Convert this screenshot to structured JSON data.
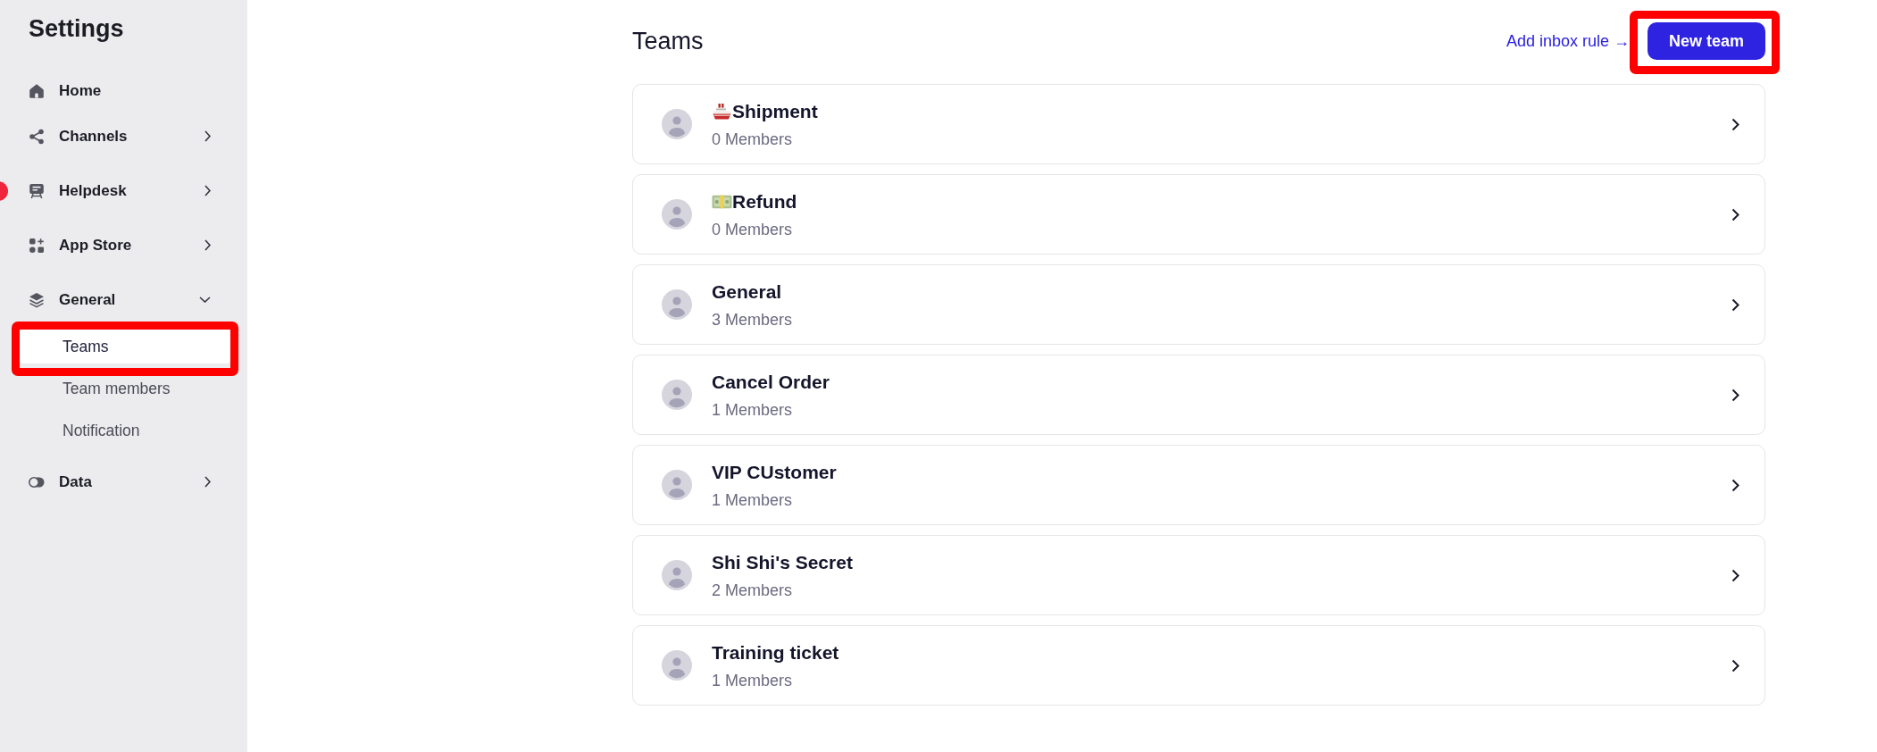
{
  "sidebar": {
    "title": "Settings",
    "items": [
      {
        "label": "Home",
        "kind": "home",
        "notification_badge": false
      },
      {
        "label": "Channels",
        "kind": "share",
        "expanded": false,
        "notification_badge": false
      },
      {
        "label": "Helpdesk",
        "kind": "board",
        "expanded": false,
        "notification_badge": true
      },
      {
        "label": "App Store",
        "kind": "apps",
        "expanded": false,
        "notification_badge": false
      },
      {
        "label": "General",
        "kind": "layers",
        "expanded": true,
        "notification_badge": false,
        "children": [
          {
            "label": "Teams",
            "selected": true,
            "highlighted": true
          },
          {
            "label": "Team members",
            "selected": false,
            "highlighted": false
          },
          {
            "label": "Notification",
            "selected": false,
            "highlighted": false
          }
        ]
      },
      {
        "label": "Data",
        "kind": "toggle",
        "expanded": false,
        "notification_badge": false
      }
    ]
  },
  "header": {
    "title": "Teams",
    "link": "Add inbox rule →",
    "new_team_button": {
      "label": "New team",
      "highlighted": true
    }
  },
  "teams": [
    {
      "name": "Shipment",
      "kind": "ship",
      "members": "0 Members"
    },
    {
      "name": "Refund",
      "kind": "money",
      "members": "0 Members"
    },
    {
      "name": "General",
      "kind": "plain",
      "members": "3 Members"
    },
    {
      "name": "Cancel Order",
      "kind": "plain",
      "members": "1 Members"
    },
    {
      "name": "VIP CUstomer",
      "kind": "plain",
      "members": "1 Members"
    },
    {
      "name": "Shi Shi's Secret",
      "kind": "plain",
      "members": "2 Members"
    },
    {
      "name": "Training ticket",
      "kind": "plain",
      "members": "1 Members"
    }
  ]
}
